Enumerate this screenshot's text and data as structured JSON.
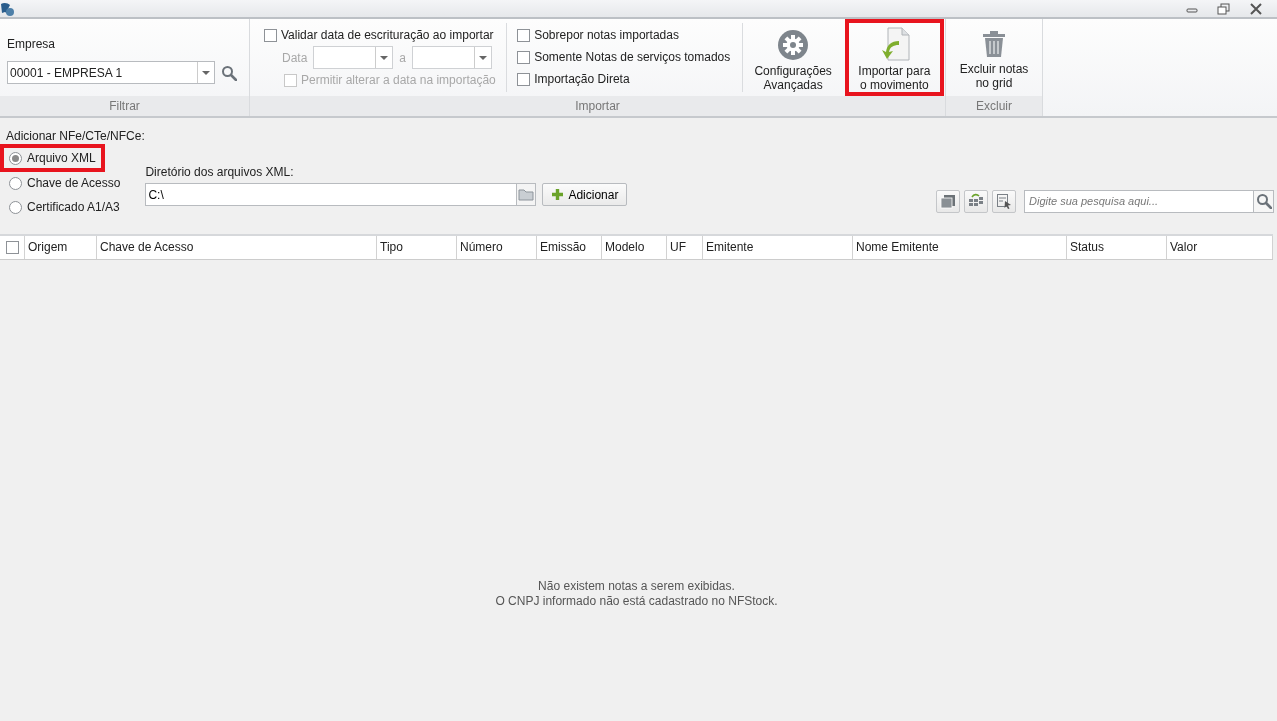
{
  "ribbon": {
    "groups": [
      {
        "label": "Filtrar"
      },
      {
        "label": "Importar"
      },
      {
        "label": "Excluir"
      }
    ],
    "empresa": {
      "label": "Empresa",
      "value": "00001 - EMPRESA 1"
    },
    "validate": {
      "label": "Validar data de escrituração ao importar",
      "checked": false
    },
    "date_range": {
      "from_label": "Data",
      "to_label": "a",
      "disabled": true
    },
    "allow_change": {
      "label": "Permitir alterar a data na importação",
      "checked": false,
      "disabled": true
    },
    "import_checks": [
      {
        "label": "Sobrepor notas importadas",
        "checked": false
      },
      {
        "label": "Somente Notas de serviços tomados",
        "checked": false
      },
      {
        "label": "Importação Direta",
        "checked": false
      }
    ],
    "actions": [
      {
        "kind": "gear",
        "label": "Configurações\nAvançadas",
        "highlighted": false
      },
      {
        "kind": "import",
        "label": "Importar para\no movimento",
        "highlighted": true
      }
    ],
    "delete_action": {
      "kind": "trash",
      "label": "Excluir notas\nno grid",
      "highlighted": false
    }
  },
  "add_panel": {
    "label": "Adicionar NFe/CTe/NFCe:",
    "sources": [
      {
        "label": "Arquivo XML",
        "selected": true,
        "highlighted": true
      },
      {
        "label": "Chave de Acesso",
        "selected": false,
        "highlighted": false
      },
      {
        "label": "Certificado A1/A3",
        "selected": false,
        "highlighted": false
      }
    ],
    "directory": {
      "label": "Diretório dos arquivos XML:",
      "value": "C:\\"
    },
    "add_button": "Adicionar"
  },
  "search": {
    "placeholder": "Digite sua pesquisa aqui..."
  },
  "table": {
    "all_checked": false,
    "columns": [
      {
        "label": "Origem"
      },
      {
        "label": "Chave de Acesso"
      },
      {
        "label": "Tipo"
      },
      {
        "label": "Número"
      },
      {
        "label": "Emissão"
      },
      {
        "label": "Modelo"
      },
      {
        "label": "UF"
      },
      {
        "label": "Emitente"
      },
      {
        "label": "Nome Emitente"
      },
      {
        "label": "Status"
      },
      {
        "label": "Valor"
      }
    ],
    "empty_message": [
      "Não existem notas a serem exibidas.",
      "O CNPJ informado não está cadastrado no NFStock."
    ]
  }
}
